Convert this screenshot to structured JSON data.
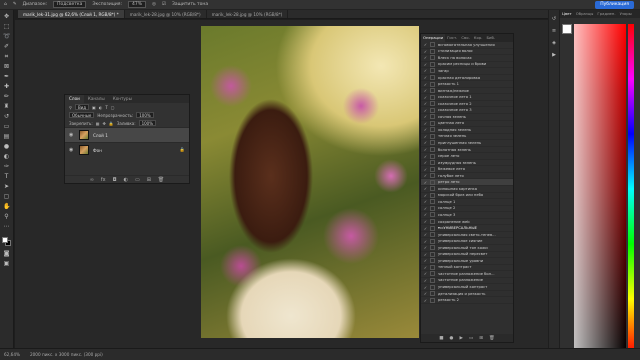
{
  "options_bar": {
    "opacity_label": "Диапазон:",
    "opacity_value": "Подсветка",
    "exposure_label": "Экспозиция:",
    "exposure_value": "47%",
    "protect_label": "Защитить тона",
    "share_label": "Публикация"
  },
  "doc_tabs": [
    "marik_lek-31.jpg @ 62,6% (Слой 1, RGB/8*) *",
    "marik_lek-28.jpg @ 10% (RGB/8*)",
    "marik_lek-28.jpg @ 10% (RGB/8*)"
  ],
  "layers_panel": {
    "tabs": [
      "Слои",
      "Каналы",
      "Контуры"
    ],
    "kind_value": "Вид",
    "blend_value": "Обычные",
    "opacity_label": "Непрозрачность:",
    "opacity_value": "100%",
    "lock_label": "Закрепить:",
    "fill_label": "Заливка:",
    "fill_value": "100%",
    "layers": [
      {
        "name": "Слой 1"
      },
      {
        "name": "Фон"
      }
    ]
  },
  "actions_panel": {
    "tabs": [
      "Операции",
      "Гист.",
      "Сво.",
      "Кор.",
      "Биб."
    ],
    "items": [
      "вспомогательная улучшения",
      "стилизация волос",
      "блеск на волосах",
      "красим ресницы и брови",
      "загар",
      "красная деталировка",
      "резкость 1",
      "винтаж/нежное",
      "сказочное лето 1",
      "сказочное лето 2",
      "сказочное лето 3",
      "сочная зелень",
      "цветная лето",
      "холодная зелень",
      "теплая зелень",
      "приглушенная зелень",
      "болотная зелень",
      "серое лето",
      "изумрудная зелень",
      "бежевое лето",
      "голубое лето",
      "ретро лето",
      "киношная картинка",
      "морской бриз или небо",
      "солнце 1",
      "солнце 2",
      "солнце 3",
      "сохранение web",
      "УНИВЕРСАЛЬНЫЕ",
      "универсальная свето-тенев...",
      "универсальное сияние",
      "универсальный тон кожи",
      "универсальный пересвет",
      "универсальные уровни",
      "теплый контраст",
      "частотное разложение бол...",
      "частотное разложение",
      "универсальный контраст",
      "детализация и резкость",
      "резкость 2"
    ]
  },
  "color_panel": {
    "tabs": [
      "Цвет",
      "Образцы",
      "Градиен.",
      "Узоры"
    ]
  },
  "status_bar": {
    "zoom": "62,64%",
    "doc_size": "2000 пикс. x 3000 пикс. (300 ppi)"
  },
  "colors": {
    "accent": "#2a6ad6",
    "panel": "#323232",
    "background": "#1e1e1e"
  }
}
